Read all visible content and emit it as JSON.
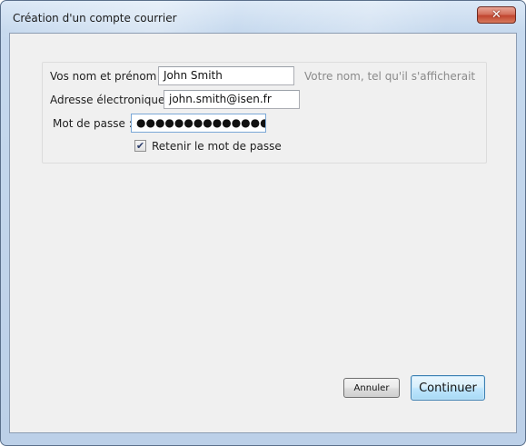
{
  "window": {
    "title": "Création d'un compte courrier",
    "close_glyph": "✕"
  },
  "form": {
    "name_label": "Vos nom et prénom :",
    "name_value": "John Smith",
    "name_hint": "Votre nom, tel qu'il s'afficherait",
    "email_label": "Adresse électronique :",
    "email_value": "john.smith@isen.fr",
    "password_label": "Mot de passe :",
    "password_masked": "●●●●●●●●●●●●●●",
    "remember_label": "Retenir le mot de passe",
    "remember_checked": true,
    "check_glyph": "✔"
  },
  "buttons": {
    "cancel_label": "Annuler",
    "continue_label": "Continuer"
  },
  "icons": {
    "close": "close-icon",
    "check": "checkmark-icon"
  }
}
